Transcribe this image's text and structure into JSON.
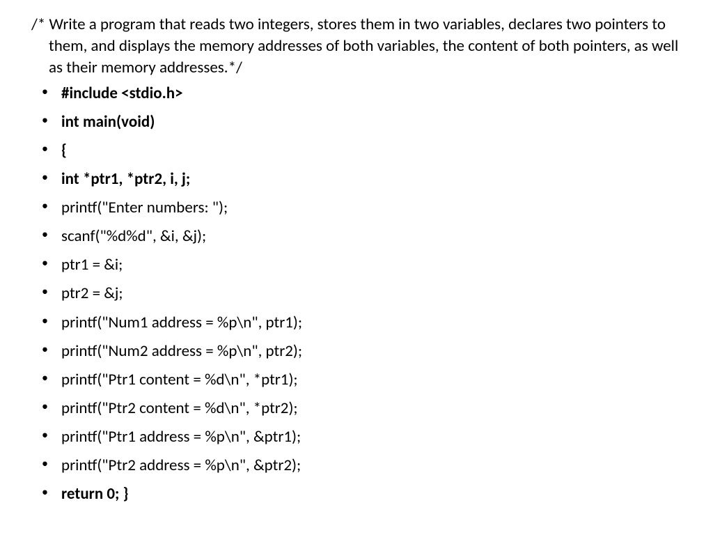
{
  "comment": "/* Write a program that reads two integers, stores them in two variables, declares two pointers to them, and displays the memory addresses of both variables, the content of both pointers, as well as their memory addresses.*/",
  "lines": [
    {
      "text": "#include <stdio.h>",
      "bold": true
    },
    {
      "text": "int main(void)",
      "bold": true
    },
    {
      "text": "{",
      "bold": true
    },
    {
      "text": "int *ptr1, *ptr2, i, j;",
      "bold": true
    },
    {
      "text": "printf(\"Enter numbers: \");",
      "bold": false
    },
    {
      "text": "scanf(\"%d%d\", &i, &j);",
      "bold": false
    },
    {
      "text": "ptr1 = &i;",
      "bold": false
    },
    {
      "text": "ptr2 = &j;",
      "bold": false
    },
    {
      "text": "printf(\"Num1 address = %p\\n\", ptr1);",
      "bold": false
    },
    {
      "text": "printf(\"Num2 address = %p\\n\", ptr2);",
      "bold": false
    },
    {
      "text": "printf(\"Ptr1 content = %d\\n\", *ptr1);",
      "bold": false
    },
    {
      "text": "printf(\"Ptr2 content = %d\\n\", *ptr2);",
      "bold": false
    },
    {
      "text": "printf(\"Ptr1 address = %p\\n\", &ptr1);",
      "bold": false
    },
    {
      "text": "printf(\"Ptr2 address = %p\\n\", &ptr2);",
      "bold": false
    },
    {
      "text": "return 0;     }",
      "bold": true
    }
  ]
}
